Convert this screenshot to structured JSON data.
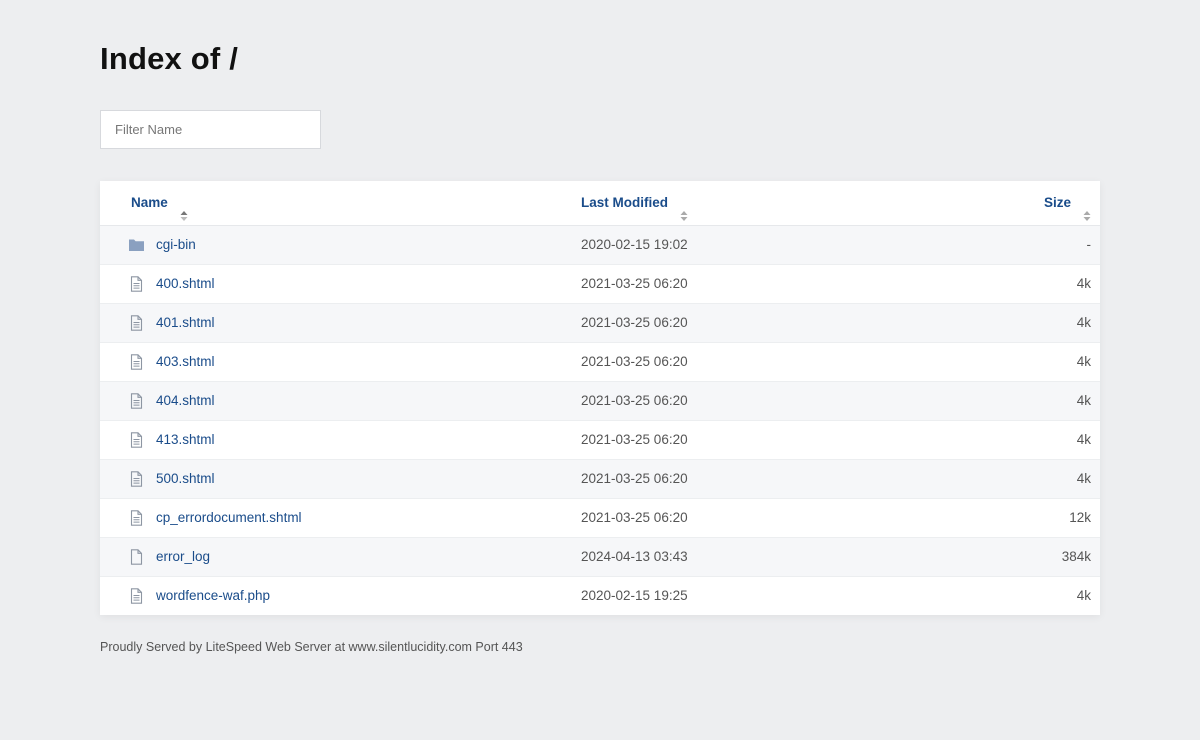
{
  "page": {
    "title": "Index of /",
    "filter_placeholder": "Filter Name"
  },
  "table": {
    "headers": {
      "name": "Name",
      "modified": "Last Modified",
      "size": "Size"
    },
    "rows": [
      {
        "icon": "folder-icon",
        "name": "cgi-bin",
        "modified": "2020-02-15 19:02",
        "size": "-"
      },
      {
        "icon": "file-text-icon",
        "name": "400.shtml",
        "modified": "2021-03-25 06:20",
        "size": "4k"
      },
      {
        "icon": "file-text-icon",
        "name": "401.shtml",
        "modified": "2021-03-25 06:20",
        "size": "4k"
      },
      {
        "icon": "file-text-icon",
        "name": "403.shtml",
        "modified": "2021-03-25 06:20",
        "size": "4k"
      },
      {
        "icon": "file-text-icon",
        "name": "404.shtml",
        "modified": "2021-03-25 06:20",
        "size": "4k"
      },
      {
        "icon": "file-text-icon",
        "name": "413.shtml",
        "modified": "2021-03-25 06:20",
        "size": "4k"
      },
      {
        "icon": "file-text-icon",
        "name": "500.shtml",
        "modified": "2021-03-25 06:20",
        "size": "4k"
      },
      {
        "icon": "file-text-icon",
        "name": "cp_errordocument.shtml",
        "modified": "2021-03-25 06:20",
        "size": "12k"
      },
      {
        "icon": "file-icon",
        "name": "error_log",
        "modified": "2024-04-13 03:43",
        "size": "384k"
      },
      {
        "icon": "file-text-icon",
        "name": "wordfence-waf.php",
        "modified": "2020-02-15 19:25",
        "size": "4k"
      }
    ]
  },
  "footer": {
    "text": "Proudly Served by LiteSpeed Web Server at www.silentlucidity.com Port 443"
  },
  "colors": {
    "link": "#1a4c8a",
    "background": "#edeef0",
    "folder_icon": "#8aa0c0",
    "file_icon": "#8d96a3"
  }
}
